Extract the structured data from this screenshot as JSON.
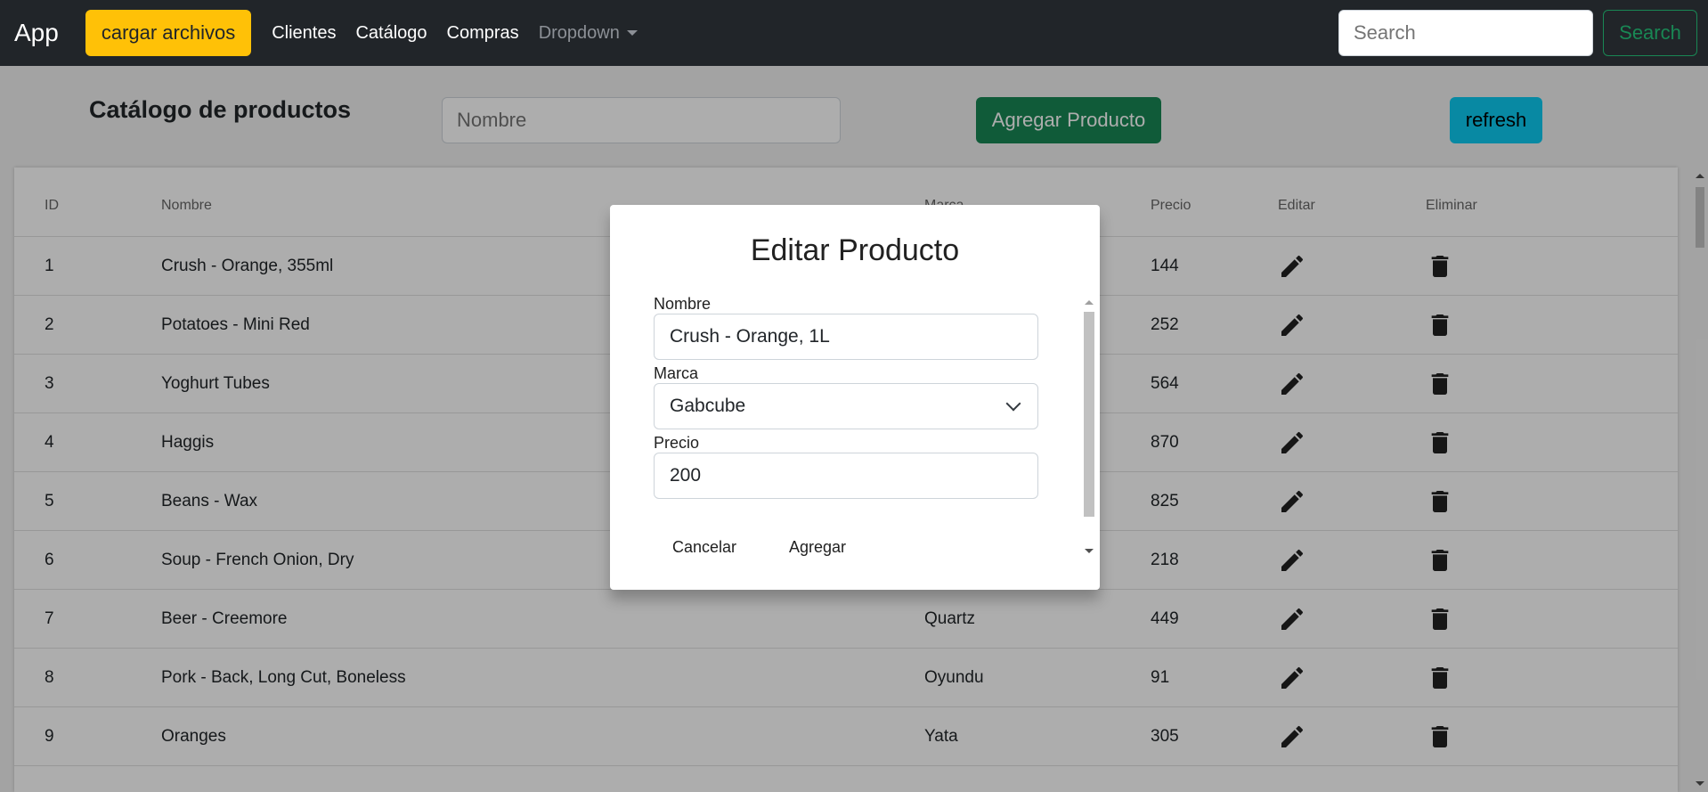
{
  "navbar": {
    "brand": "App",
    "upload_button": "cargar archivos",
    "links": [
      "Clientes",
      "Catálogo",
      "Compras"
    ],
    "dropdown": "Dropdown",
    "search_placeholder": "Search",
    "search_button": "Search"
  },
  "page": {
    "title": "Catálogo de productos",
    "name_placeholder": "Nombre",
    "add_button": "Agregar Producto",
    "refresh_button": "refresh"
  },
  "table": {
    "headers": [
      "ID",
      "Nombre",
      "Marca",
      "Precio",
      "Editar",
      "Eliminar"
    ],
    "rows": [
      {
        "id": "1",
        "name": "Crush - Orange, 355ml",
        "brand": "",
        "price": "144"
      },
      {
        "id": "2",
        "name": "Potatoes - Mini Red",
        "brand": "",
        "price": "252"
      },
      {
        "id": "3",
        "name": "Yoghurt Tubes",
        "brand": "",
        "price": "564"
      },
      {
        "id": "4",
        "name": "Haggis",
        "brand": "",
        "price": "870"
      },
      {
        "id": "5",
        "name": "Beans - Wax",
        "brand": "",
        "price": "825"
      },
      {
        "id": "6",
        "name": "Soup - French Onion, Dry",
        "brand": "",
        "price": "218"
      },
      {
        "id": "7",
        "name": "Beer - Creemore",
        "brand": "Quartz",
        "price": "449"
      },
      {
        "id": "8",
        "name": "Pork - Back, Long Cut, Boneless",
        "brand": "Oyundu",
        "price": "91"
      },
      {
        "id": "9",
        "name": "Oranges",
        "brand": "Yata",
        "price": "305"
      }
    ],
    "edit_icon": "pencil-icon",
    "delete_icon": "trash-icon"
  },
  "modal": {
    "title": "Editar Producto",
    "name_label": "Nombre",
    "name_value": "Crush - Orange, 1L",
    "brand_label": "Marca",
    "brand_value": "Gabcube",
    "price_label": "Precio",
    "price_value": "200",
    "cancel_button": "Cancelar",
    "submit_button": "Agregar"
  },
  "colors": {
    "navbar": "#212529",
    "warning": "#ffc107",
    "success": "#198754",
    "info": "#0dcaf0"
  }
}
